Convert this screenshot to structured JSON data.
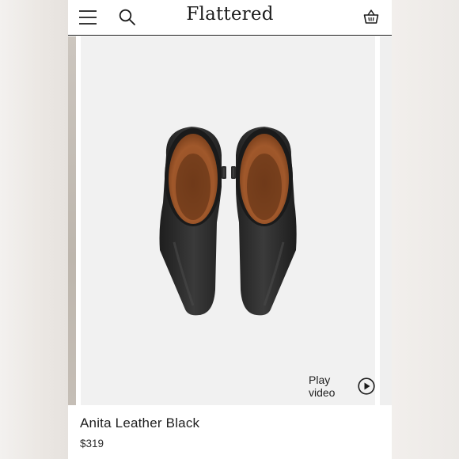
{
  "header": {
    "logo": "Flattered",
    "menu_icon": "hamburger-menu-icon",
    "search_icon": "search-icon",
    "basket_icon": "shopping-basket-icon"
  },
  "gallery": {
    "play_video_label": "Play video",
    "play_icon": "play-circle-icon"
  },
  "product": {
    "name": "Anita Leather Black",
    "price": "$319"
  },
  "colors": {
    "text": "#1b1b1b",
    "image_background": "#f1f1f1",
    "boot_leather": "#2b2b2b",
    "boot_lining": "#a0522d"
  }
}
